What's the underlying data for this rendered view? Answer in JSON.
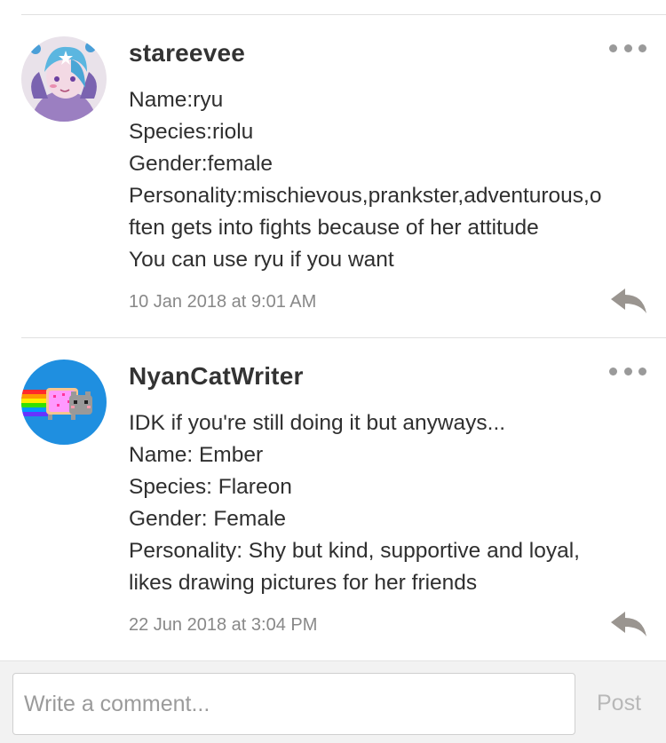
{
  "comments": [
    {
      "username": "stareevee",
      "avatar_icon": "anime-character-avatar-icon",
      "lines": [
        "Name:ryu",
        "Species:riolu",
        "Gender:female",
        "Personality:mischievous,prankster,adventurous,o",
        "ften gets into fights because of her attitude",
        "You can use ryu if you want"
      ],
      "timestamp": "10 Jan 2018 at 9:01 AM"
    },
    {
      "username": "NyanCatWriter",
      "avatar_icon": "nyan-cat-avatar-icon",
      "lines": [
        "IDK if you're still doing it but anyways...",
        "Name: Ember",
        "Species: Flareon",
        "Gender: Female",
        "Personality: Shy but kind, supportive and loyal,",
        "likes drawing pictures for her friends"
      ],
      "timestamp": "22 Jun 2018 at 3:04 PM"
    }
  ],
  "icons": {
    "more": "more-options-icon",
    "reply": "reply-arrow-icon"
  },
  "composer": {
    "placeholder": "Write a comment...",
    "value": "",
    "post_label": "Post"
  },
  "colors": {
    "text": "#2f2f2f",
    "muted": "#888888",
    "divider": "#e0e0e0",
    "composer_bg": "#f2f2f2",
    "post_disabled": "#b8b8b8"
  }
}
